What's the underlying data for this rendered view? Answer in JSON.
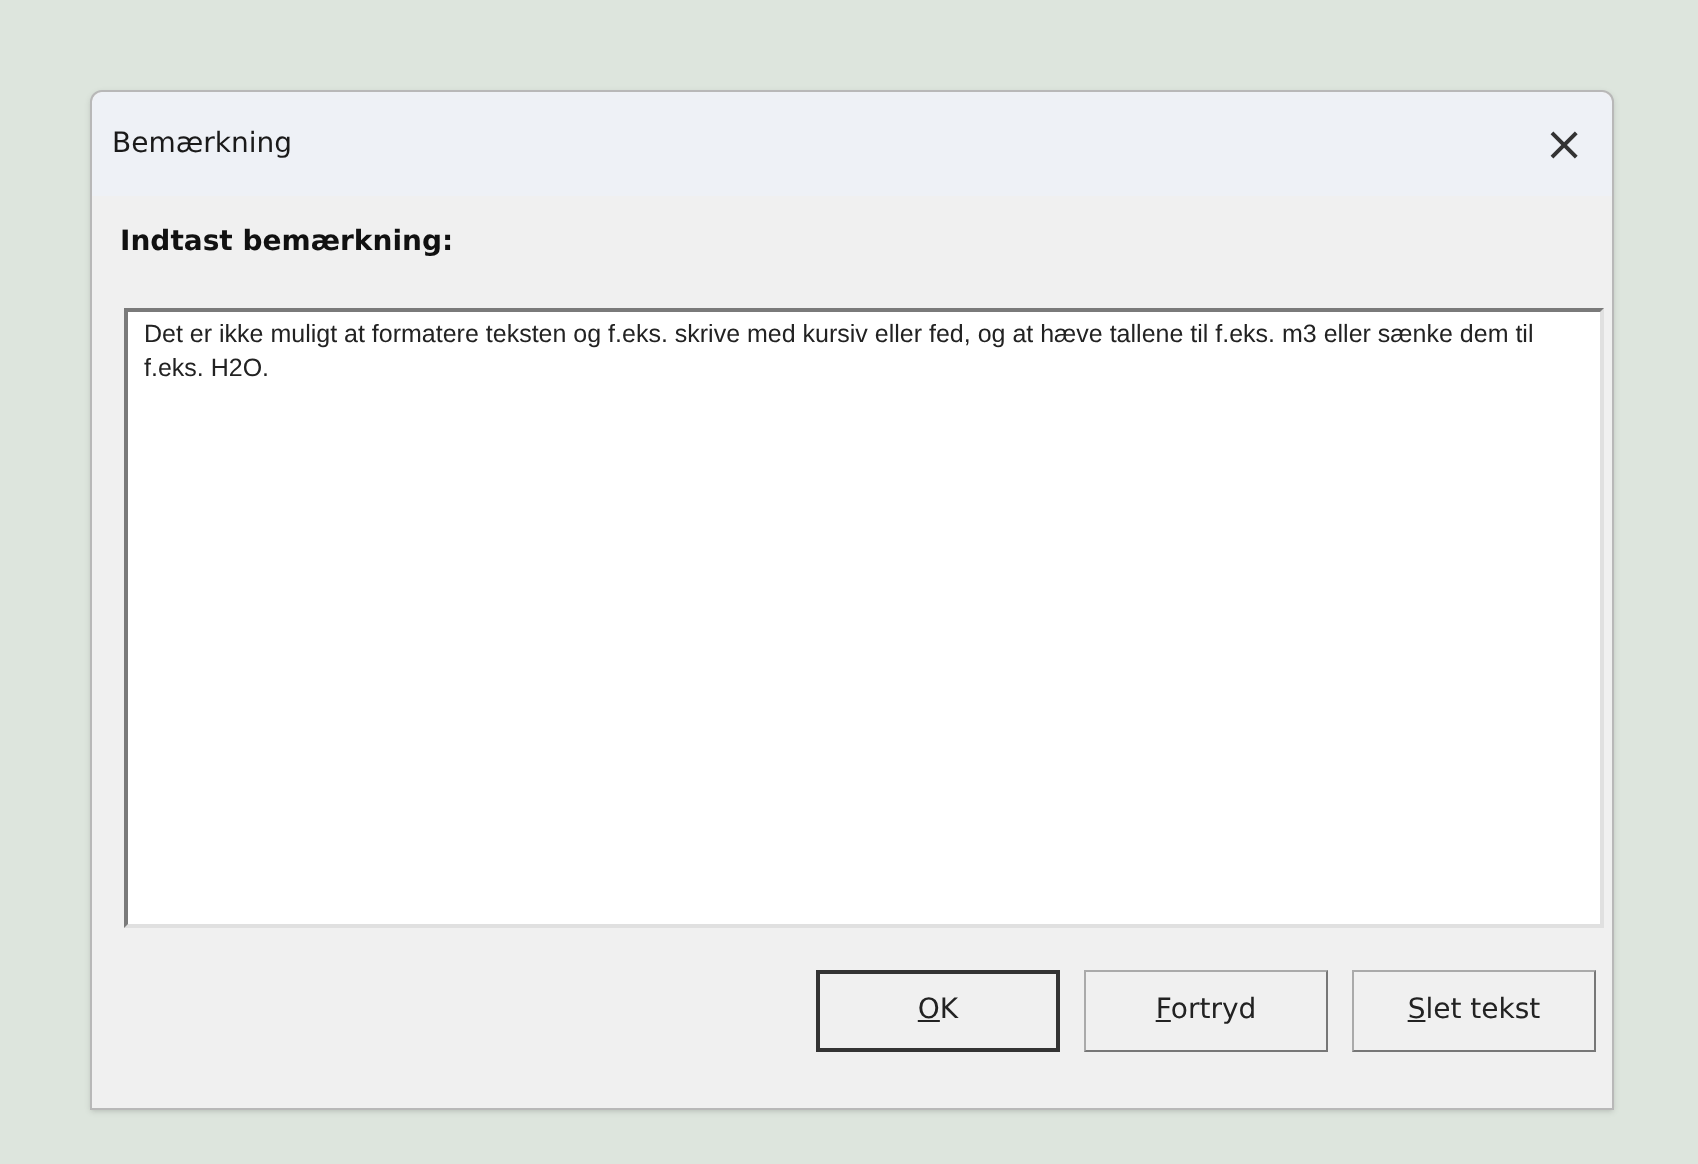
{
  "window": {
    "title": "Bemærkning",
    "close": "×"
  },
  "prompt": "Indtast bemærkning:",
  "remark": {
    "value": "Det er ikke muligt at formatere teksten og f.eks. skrive med kursiv eller fed, og at hæve tallene til f.eks. m3 eller sænke dem til f.eks. H2O."
  },
  "buttons": [
    {
      "key": "O",
      "rest": "K",
      "default": true
    },
    {
      "key": "F",
      "rest": "ortryd",
      "default": false
    },
    {
      "key": "S",
      "rest": "let tekst",
      "default": false
    }
  ]
}
